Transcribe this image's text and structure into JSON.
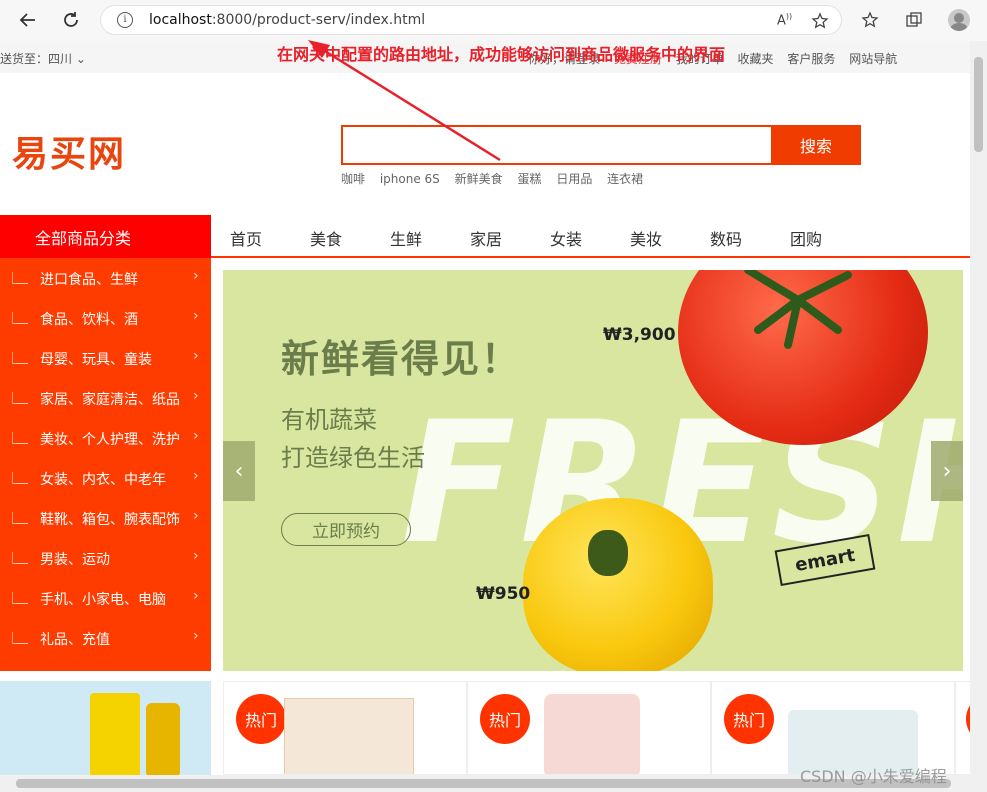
{
  "browser": {
    "url_host": "localhost",
    "url_rest": ":8000/product-serv/index.html"
  },
  "topbar": {
    "ship_to": "送货至：四川",
    "links": [
      "你好，请登录",
      "免费注册",
      "我的订单",
      "收藏夹",
      "客户服务",
      "网站导航"
    ]
  },
  "annotation": "在网关中配置的路由地址，成功能够访问到商品微服务中的界面",
  "logo": "易买网",
  "search": {
    "button": "搜索",
    "hotwords": [
      "咖啡",
      "iphone 6S",
      "新鲜美食",
      "蛋糕",
      "日用品",
      "连衣裙"
    ]
  },
  "categories_header": "全部商品分类",
  "main_nav": [
    "首页",
    "美食",
    "生鲜",
    "家居",
    "女装",
    "美妆",
    "数码",
    "团购"
  ],
  "categories": [
    "进口食品、生鲜",
    "食品、饮料、酒",
    "母婴、玩具、童装",
    "家居、家庭清洁、纸品",
    "美妆、个人护理、洗护",
    "女装、内衣、中老年",
    "鞋靴、箱包、腕表配饰",
    "男装、运动",
    "手机、小家电、电脑",
    "礼品、充值"
  ],
  "banner": {
    "title": "新鲜看得见！",
    "sub1": "有机蔬菜",
    "sub2": "打造绿色生活",
    "button": "立即预约",
    "price1": "₩3,900",
    "price2": "₩950",
    "fresh_text": "FRESH",
    "brand": "emart"
  },
  "hot_label": "热门",
  "watermark": "CSDN @小朱爱编程"
}
